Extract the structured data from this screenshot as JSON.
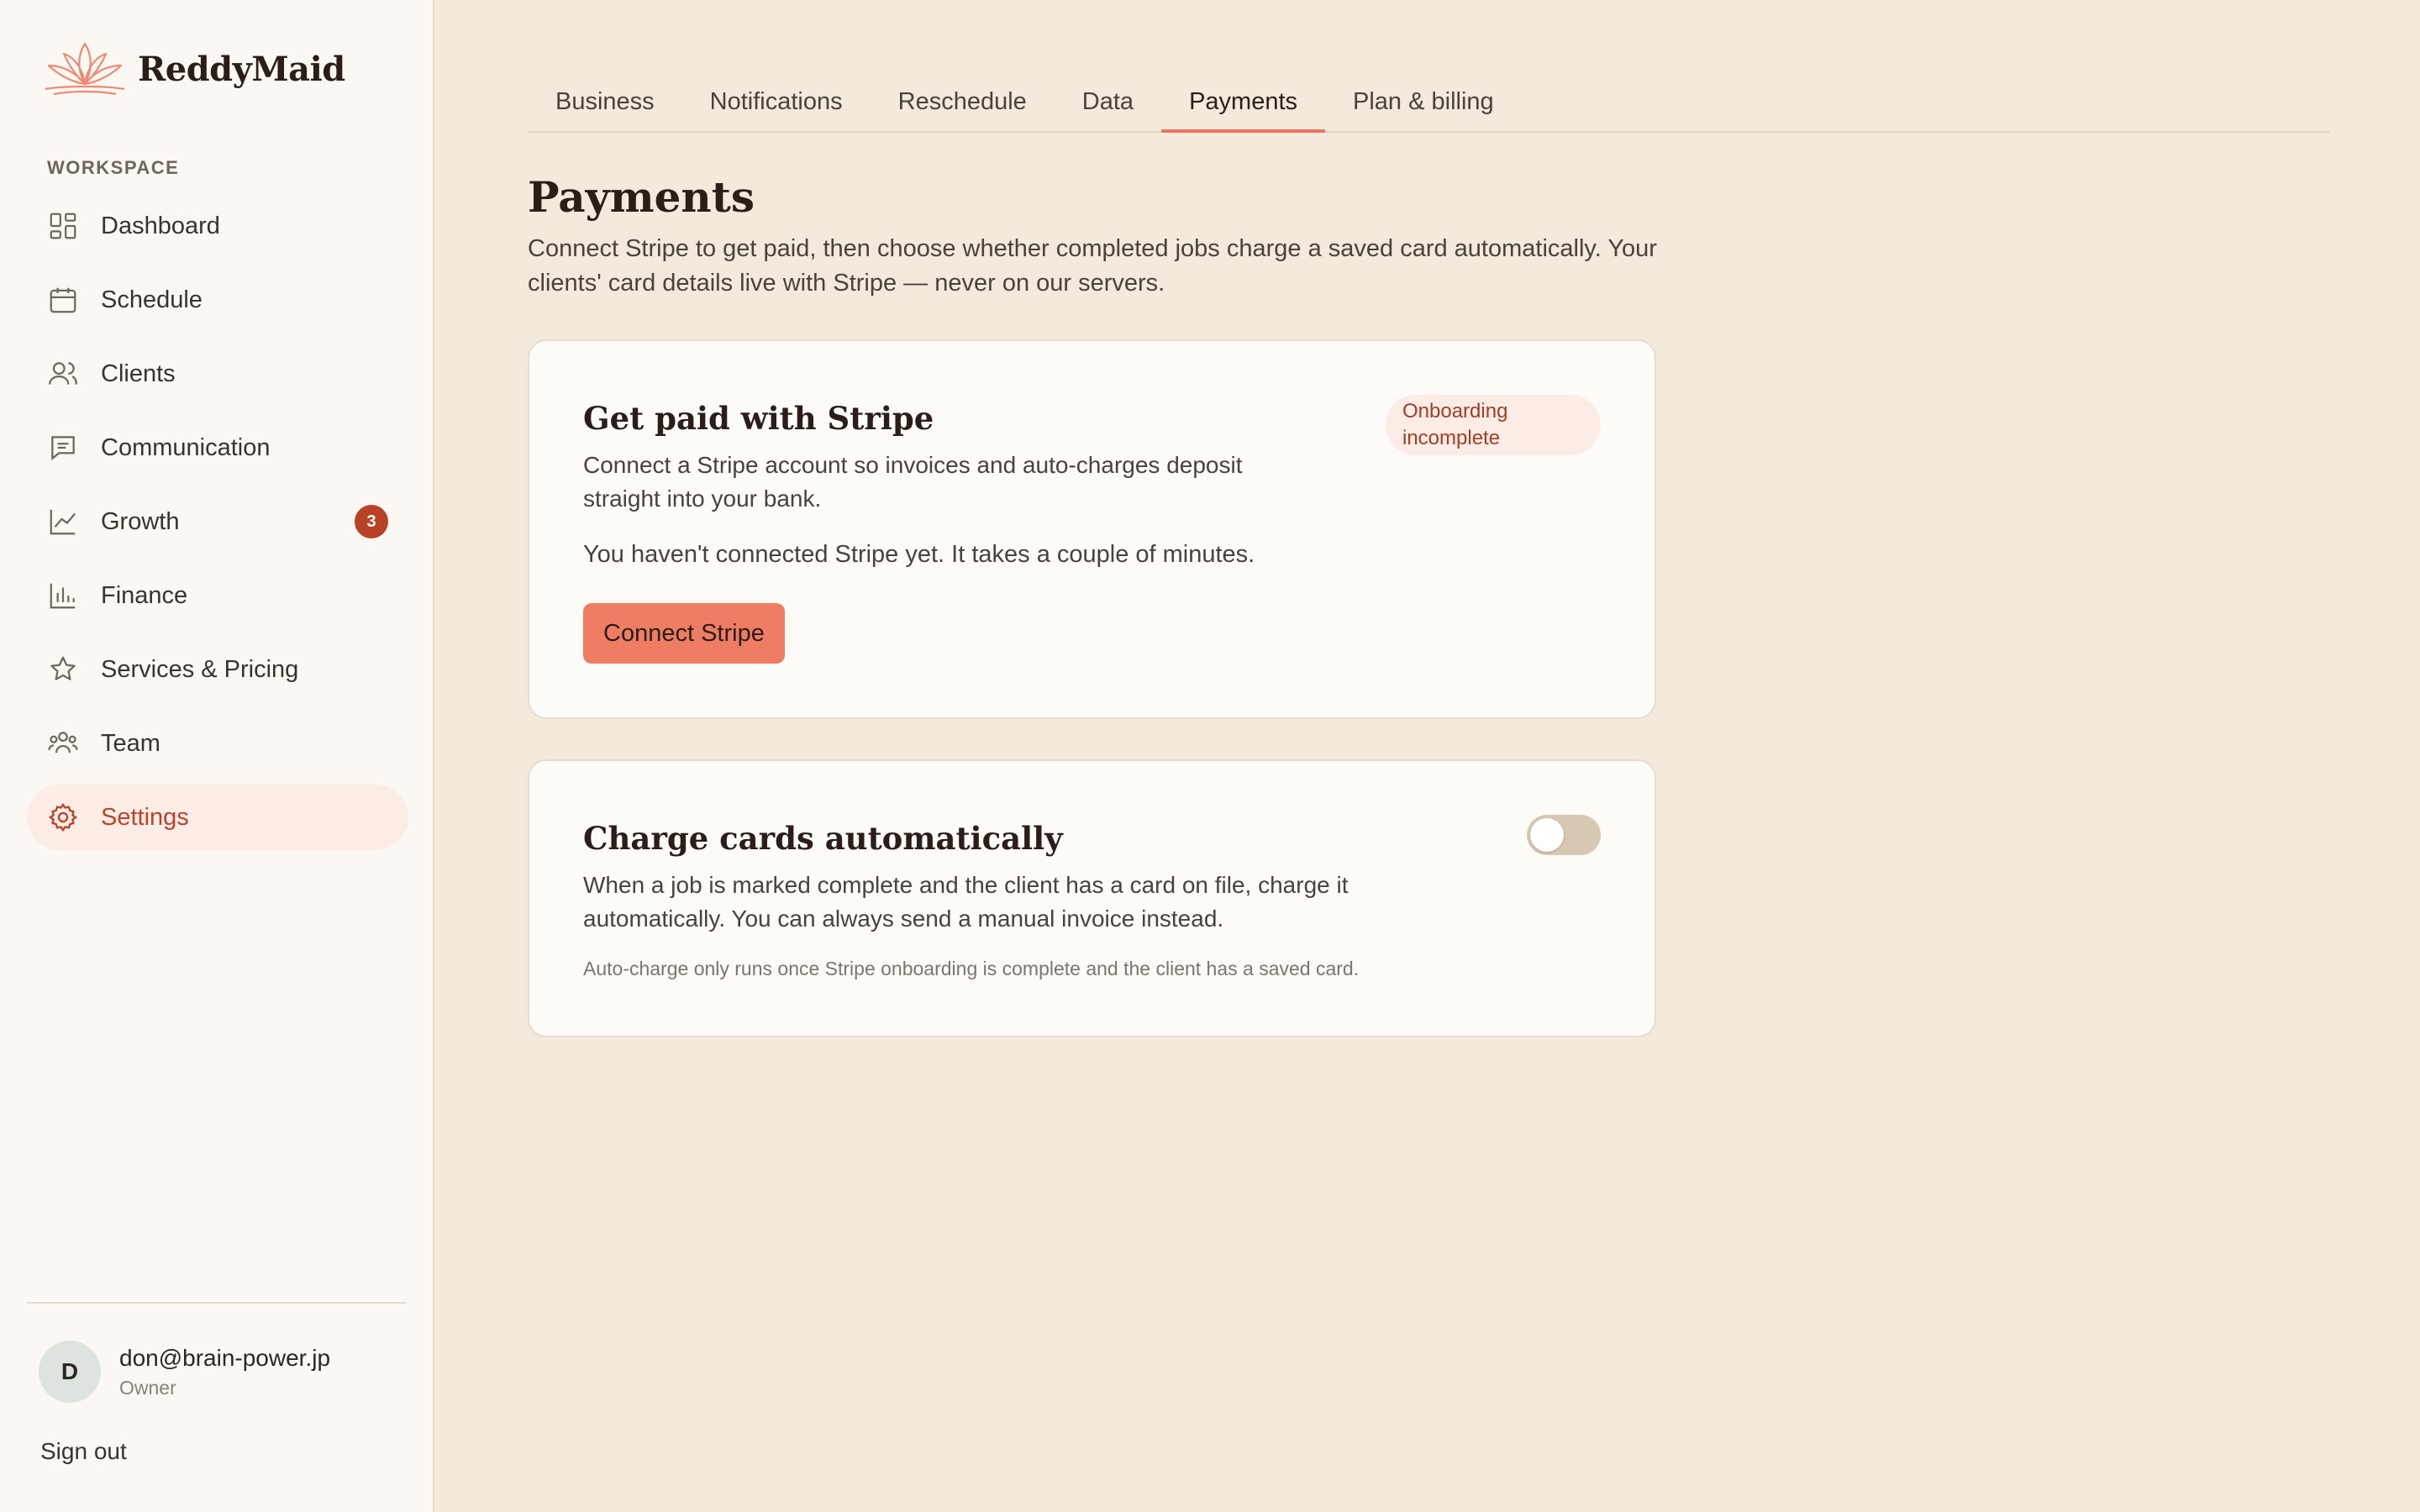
{
  "brand": {
    "name": "ReddyMaid",
    "logo_icon": "lotus-logo",
    "accent": "#e8775c"
  },
  "sidebar": {
    "section_label": "WORKSPACE",
    "items": [
      {
        "label": "Dashboard",
        "icon": "dashboard-icon"
      },
      {
        "label": "Schedule",
        "icon": "calendar-icon"
      },
      {
        "label": "Clients",
        "icon": "users-icon"
      },
      {
        "label": "Communication",
        "icon": "message-icon"
      },
      {
        "label": "Growth",
        "icon": "trending-up-icon",
        "badge": "3"
      },
      {
        "label": "Finance",
        "icon": "bar-chart-icon"
      },
      {
        "label": "Services & Pricing",
        "icon": "star-icon"
      },
      {
        "label": "Team",
        "icon": "team-icon"
      },
      {
        "label": "Settings",
        "icon": "gear-icon",
        "active": true
      }
    ],
    "user": {
      "initial": "D",
      "email": "don@brain-power.jp",
      "role": "Owner"
    },
    "sign_out": "Sign out"
  },
  "tabs": [
    "Business",
    "Notifications",
    "Reschedule",
    "Data",
    "Payments",
    "Plan & billing"
  ],
  "active_tab": "Payments",
  "page": {
    "title": "Payments",
    "description": "Connect Stripe to get paid, then choose whether completed jobs charge a saved card automatically. Your clients' card details live with Stripe — never on our servers."
  },
  "stripe_card": {
    "title": "Get paid with Stripe",
    "description": "Connect a Stripe account so invoices and auto-charges deposit straight into your bank.",
    "status": "Onboarding incomplete",
    "note": "You haven't connected Stripe yet. It takes a couple of minutes.",
    "button": "Connect Stripe"
  },
  "auto_charge_card": {
    "title": "Charge cards automatically",
    "description": "When a job is marked complete and the client has a card on file, charge it automatically. You can always send a manual invoice instead.",
    "fine_print": "Auto-charge only runs once Stripe onboarding is complete and the client has a saved card.",
    "toggle_on": false
  }
}
